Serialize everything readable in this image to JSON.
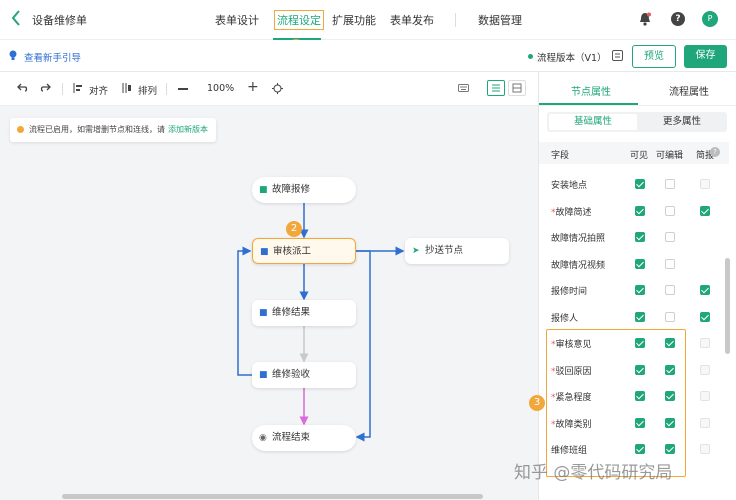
{
  "app": {
    "title": "设备维修单",
    "back_icon": "chevron-left-icon"
  },
  "nav": {
    "tabs": [
      "表单设计",
      "流程设定",
      "扩展功能",
      "表单发布",
      "数据管理"
    ],
    "active": "流程设定"
  },
  "header_icons": {
    "bell": "bell-icon",
    "help": "help-icon",
    "avatar": "P"
  },
  "subbar": {
    "guide": "查看新手引导",
    "version": "流程版本（V1）",
    "preview": "预览",
    "save": "保存"
  },
  "toolbar": {
    "align": "对齐",
    "arrange": "排列",
    "zoom": "100%"
  },
  "notice": {
    "text": "流程已启用，如需增删节点和连线，请",
    "link": "添加新版本"
  },
  "nodes": {
    "start": "故障报修",
    "review": "审核派工",
    "copy": "抄送节点",
    "result": "维修结果",
    "check": "维修验收",
    "end": "流程结束"
  },
  "panel": {
    "tabs": [
      "节点属性",
      "流程属性"
    ],
    "subtabs": [
      "基础属性",
      "更多属性"
    ],
    "headers": {
      "field": "字段",
      "visible": "可见",
      "editable": "可编辑",
      "brief": "简报"
    },
    "rows": [
      {
        "label": "安装地点",
        "req": false,
        "v": "on",
        "e": "off",
        "b": "dis"
      },
      {
        "label": "故障简述",
        "req": true,
        "v": "on",
        "e": "off",
        "b": "on"
      },
      {
        "label": "故障情况拍照",
        "req": false,
        "v": "on",
        "e": "off",
        "b": ""
      },
      {
        "label": "故障情况视频",
        "req": false,
        "v": "on",
        "e": "off",
        "b": ""
      },
      {
        "label": "报修时间",
        "req": false,
        "v": "on",
        "e": "off",
        "b": "on"
      },
      {
        "label": "报修人",
        "req": false,
        "v": "on",
        "e": "off",
        "b": "on"
      },
      {
        "label": "审核意见",
        "req": true,
        "v": "on",
        "e": "on",
        "b": "dis"
      },
      {
        "label": "驳回原因",
        "req": true,
        "v": "on",
        "e": "on",
        "b": "dis"
      },
      {
        "label": "紧急程度",
        "req": true,
        "v": "on",
        "e": "on",
        "b": "dis"
      },
      {
        "label": "故障类别",
        "req": true,
        "v": "on",
        "e": "on",
        "b": "dis"
      },
      {
        "label": "维修班组",
        "req": false,
        "v": "on",
        "e": "on",
        "b": "dis"
      }
    ]
  },
  "badges": [
    "1",
    "2",
    "3"
  ],
  "watermark": "知乎 @零代码研究局",
  "colors": {
    "accent": "#1fa67a",
    "badge": "#f2a73b",
    "blue_line": "#2f6fd1"
  }
}
